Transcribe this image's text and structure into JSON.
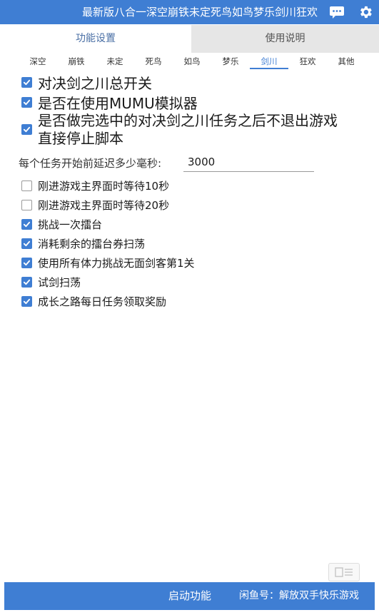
{
  "titlebar": {
    "title": "最新版八合一深空崩铁未定死鸟如鸟梦乐剑川狂欢",
    "chat_icon": "chat-bubble-icon",
    "gear_icon": "gear-icon"
  },
  "tabs": [
    {
      "label": "功能设置",
      "active": true
    },
    {
      "label": "使用说明",
      "active": false
    }
  ],
  "subtabs": [
    "深空",
    "崩铁",
    "未定",
    "死鸟",
    "如鸟",
    "梦乐",
    "剑川",
    "狂欢",
    "其他"
  ],
  "active_subtab": "剑川",
  "big_options": [
    {
      "label": "对决剑之川总开关",
      "checked": true
    },
    {
      "label": "是否在使用MUMU模拟器",
      "checked": true
    },
    {
      "label": "是否做完选中的对决剑之川任务之后不退出游戏",
      "label2": "直接停止脚本",
      "checked": true
    }
  ],
  "delay": {
    "label": "每个任务开始前延迟多少毫秒:",
    "value": "3000"
  },
  "small_options": [
    {
      "label": "刚进游戏主界面时等待10秒",
      "checked": false
    },
    {
      "label": "刚进游戏主界面时等待20秒",
      "checked": false
    },
    {
      "label": "挑战一次擂台",
      "checked": true
    },
    {
      "label": "消耗剩余的擂台券扫荡",
      "checked": true
    },
    {
      "label": "使用所有体力挑战无面剑客第1关",
      "checked": true
    },
    {
      "label": "试剑扫荡",
      "checked": true
    },
    {
      "label": "成长之路每日任务领取奖励",
      "checked": true
    }
  ],
  "bottombar": {
    "start_label": "启动功能",
    "xianyu_label": "闲鱼号：解放双手快乐游戏"
  },
  "colors": {
    "accent": "#3f7ed3",
    "inactive_tab": "#e6e6e6"
  }
}
